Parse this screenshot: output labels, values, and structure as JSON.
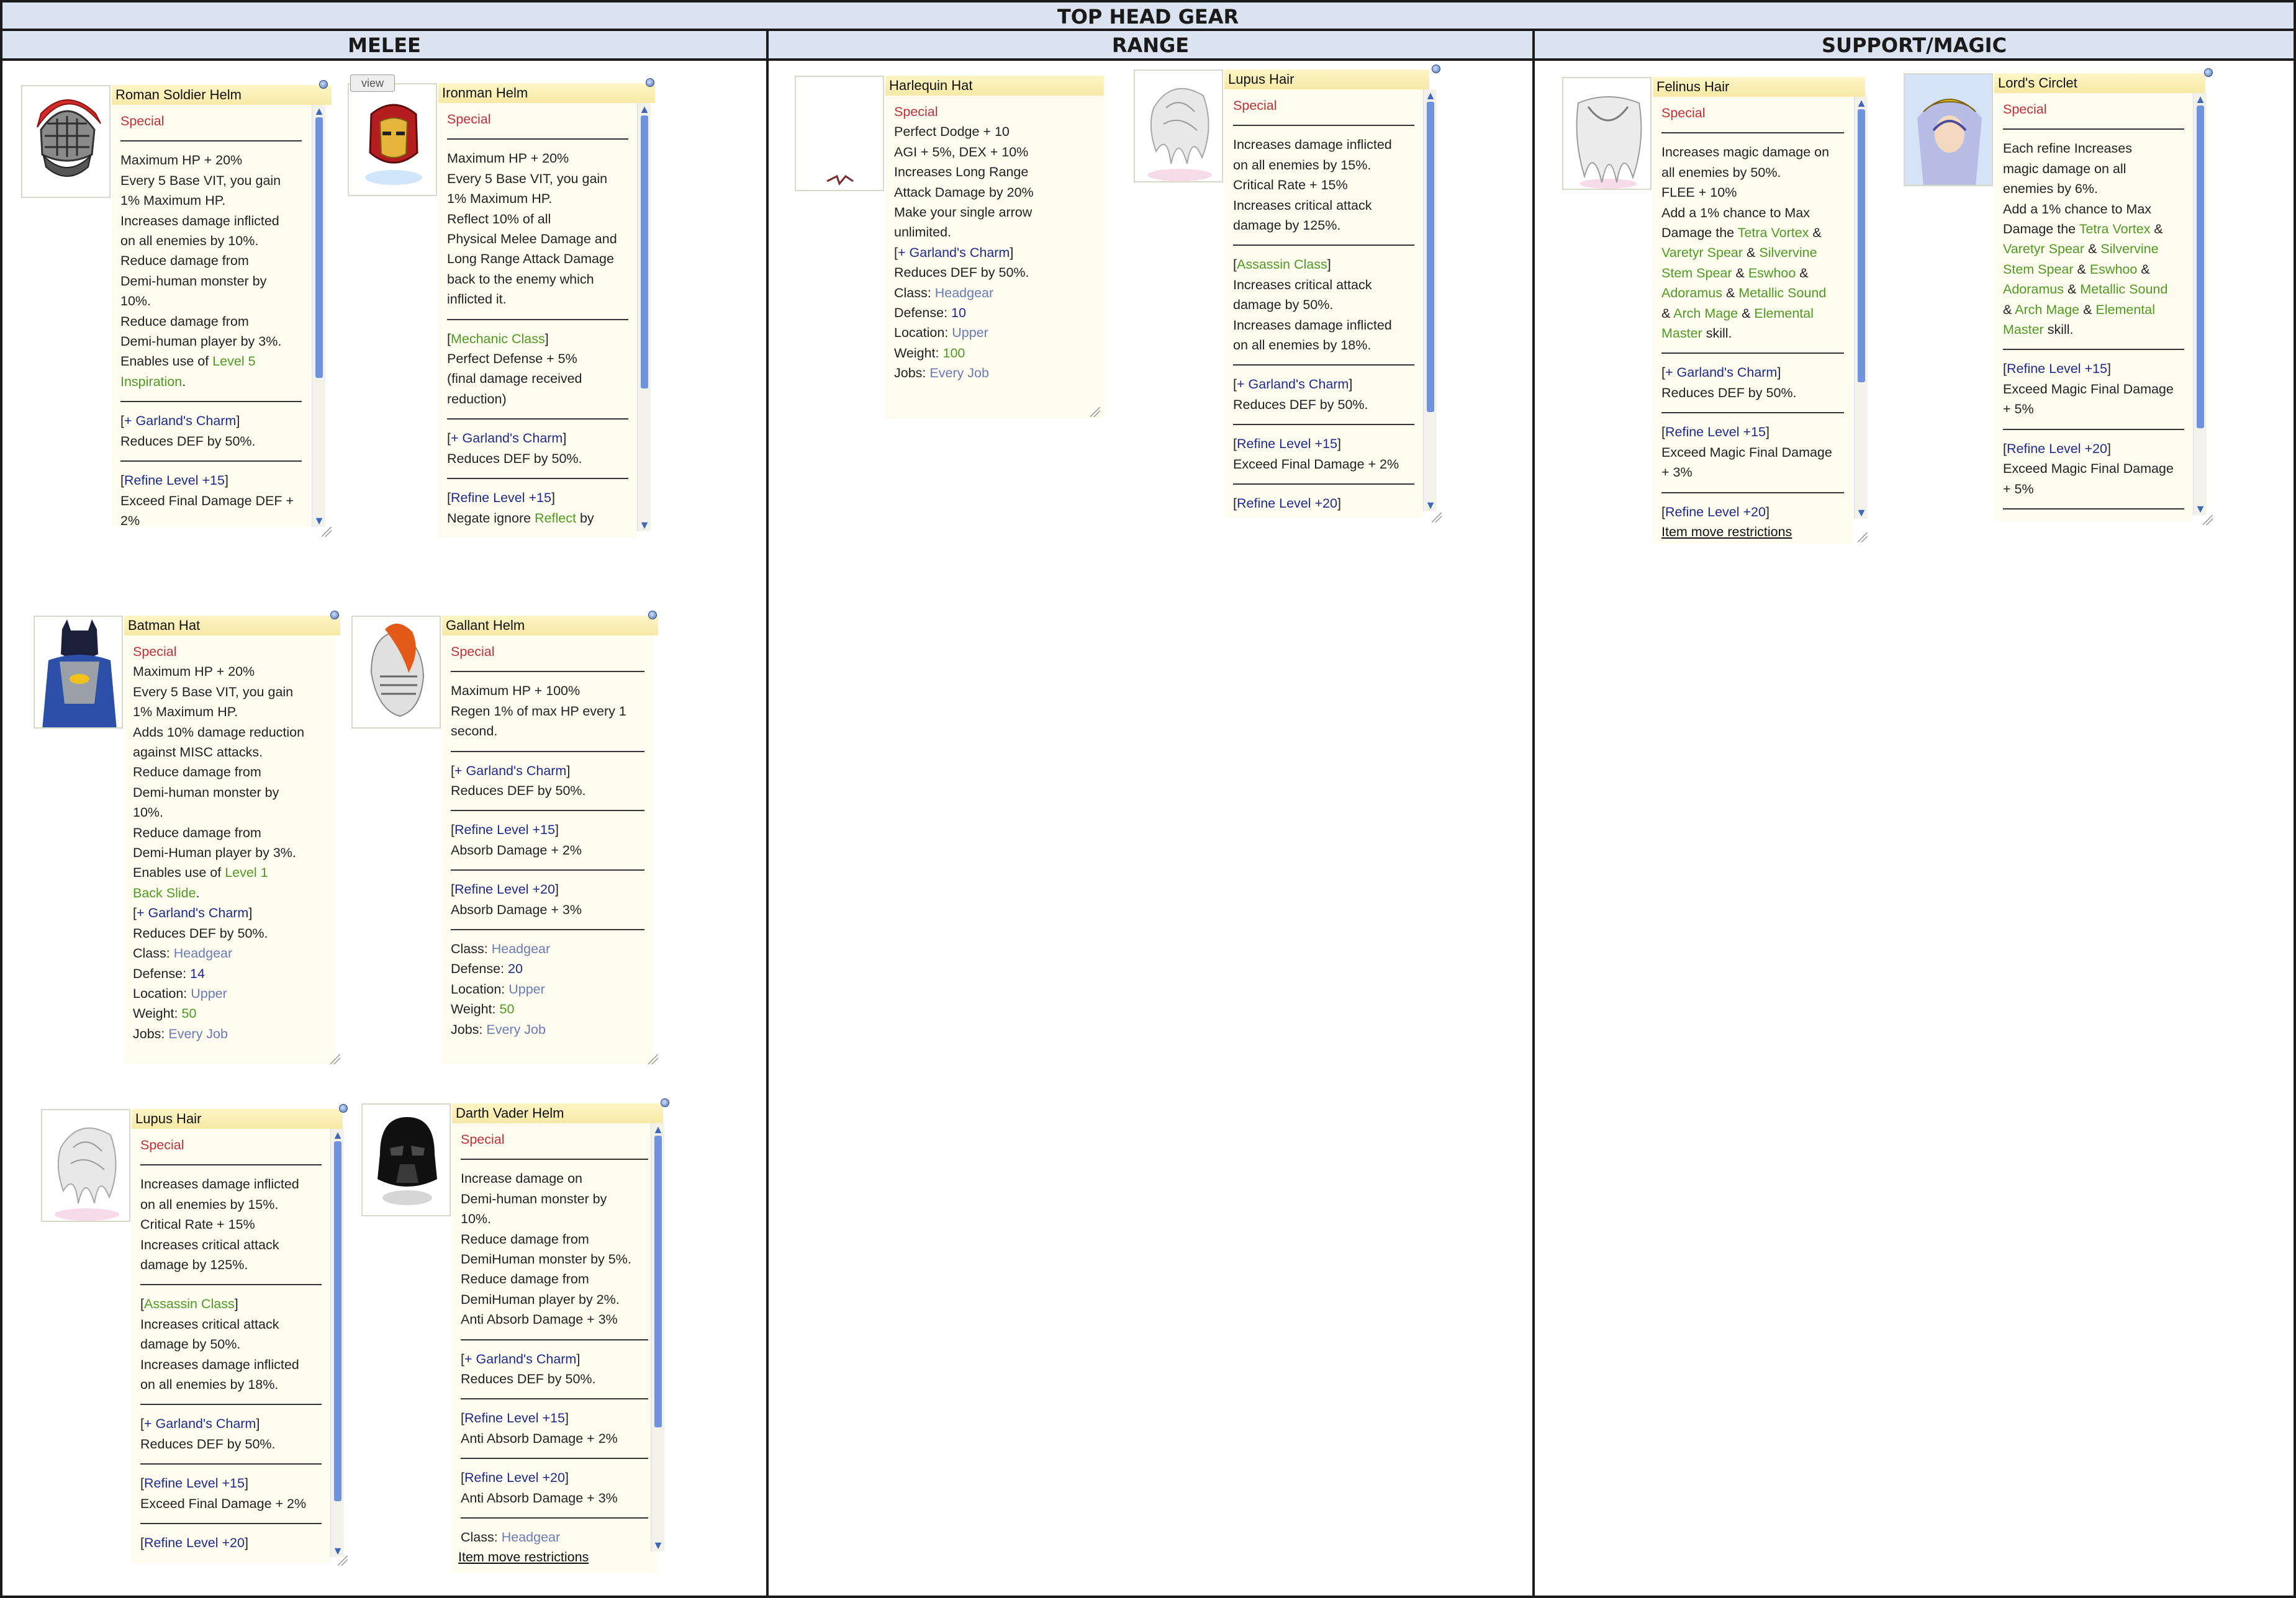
{
  "title": "TOP HEAD GEAR",
  "columns": {
    "melee": "MELEE",
    "range": "RANGE",
    "support": "SUPPORT/MAGIC"
  },
  "cards": {
    "roman": {
      "name": "Roman Soldier Helm",
      "lines": [
        "Special",
        "Maximum HP + 20%",
        "Every 5 Base VIT, you gain",
        "1% Maximum HP.",
        "Increases damage inflicted",
        "on all enemies by 10%.",
        "Reduce damage from",
        "Demi-human monster by",
        "10%.",
        "Reduce damage from",
        "Demi-human player by 3%.",
        "Enables use of ",
        "Level 5",
        "Inspiration",
        ".",
        "[",
        "+ Garland's Charm",
        "]",
        "Reduces DEF by 50%.",
        "[",
        "Refine Level +15",
        "]",
        "Exceed Final Damage DEF +",
        "2%"
      ]
    },
    "ironman": {
      "name": "Ironman Helm",
      "view": "view",
      "lines": [
        "Special",
        "Maximum HP + 20%",
        "Every 5 Base VIT, you gain",
        "1% Maximum HP.",
        "Reflect 10% of all",
        "Physical Melee Damage and",
        "Long Range Attack Damage",
        "back to the enemy which",
        "inflicted it.",
        "[",
        "Mechanic Class",
        "]",
        "Perfect Defense + 5%",
        "(final damage received",
        "reduction)",
        "[",
        "+ Garland's Charm",
        "]",
        "Reduces DEF by 50%.",
        "[",
        "Refine Level +15",
        "]",
        "Negate ignore ",
        "Reflect",
        " by"
      ]
    },
    "batman": {
      "name": "Batman Hat",
      "lines": [
        "Special",
        "Maximum HP + 20%",
        "Every 5 Base VIT, you gain",
        "1% Maximum HP.",
        "Adds 10% damage reduction",
        "against MISC attacks.",
        "Reduce damage from",
        "Demi-human monster by",
        "10%.",
        "Reduce damage from",
        "Demi-Human player by 3%.",
        "Enables use of ",
        "Level 1",
        "Back Slide",
        ".",
        "[",
        "+ Garland's Charm",
        "]",
        "Reduces DEF by 50%.",
        "Class: ",
        "Headgear",
        "Defense: ",
        "14",
        "Location: ",
        "Upper",
        "Weight: ",
        "50",
        "Jobs: ",
        "Every Job"
      ]
    },
    "gallant": {
      "name": "Gallant Helm",
      "lines": [
        "Special",
        "Maximum HP + 100%",
        "Regen 1% of max HP every 1",
        "second.",
        "[",
        "+ Garland's Charm",
        "]",
        "Reduces DEF by 50%.",
        "[",
        "Refine Level +15",
        "]",
        "Absorb Damage + 2%",
        "[",
        "Refine Level +20",
        "]",
        "Absorb Damage + 3%",
        "Class: ",
        "Headgear",
        "Defense: ",
        "20",
        "Location: ",
        "Upper",
        "Weight: ",
        "50",
        "Jobs: ",
        "Every Job"
      ]
    },
    "lupus1": {
      "name": "Lupus Hair",
      "lines": [
        "Special",
        "Increases damage inflicted",
        "on all enemies by 15%.",
        "Critical Rate + 15%",
        "Increases critical attack",
        "damage by 125%.",
        "[",
        "Assassin Class",
        "]",
        "Increases critical attack",
        "damage by 50%.",
        "Increases damage inflicted",
        "on all enemies by 18%.",
        "[",
        "+ Garland's Charm",
        "]",
        "Reduces DEF by 50%.",
        "[",
        "Refine Level +15",
        "]",
        "Exceed Final Damage + 2%",
        "[",
        "Refine Level +20",
        "]"
      ]
    },
    "vader": {
      "name": "Darth Vader Helm",
      "lines": [
        "Special",
        "Increase damage on",
        "Demi-human monster by",
        "10%.",
        "Reduce damage from",
        "DemiHuman monster by 5%.",
        "Reduce damage from",
        "DemiHuman player by 2%.",
        "Anti Absorb Damage + 3%",
        "[",
        "+ Garland's Charm",
        "]",
        "Reduces DEF by 50%.",
        "[",
        "Refine Level +15",
        "]",
        "Anti Absorb Damage + 2%",
        "[",
        "Refine Level +20",
        "]",
        "Anti Absorb Damage + 3%",
        "Class: ",
        "Headgear",
        "Item move restrictions"
      ]
    },
    "harlequin": {
      "name": "Harlequin Hat",
      "lines": [
        "Special",
        "Perfect Dodge + 10",
        "AGI + 5%, DEX + 10%",
        "Increases Long Range",
        "Attack Damage by 20%",
        "Make your single arrow",
        "unlimited.",
        "[",
        "+ Garland's Charm",
        "]",
        "Reduces DEF by 50%.",
        "Class: ",
        "Headgear",
        "Defense: ",
        "10",
        "Location: ",
        "Upper",
        "Weight: ",
        "100",
        "Jobs: ",
        "Every Job"
      ]
    },
    "lupus2": {
      "name": "Lupus Hair",
      "lines": [
        "Special",
        "Increases damage inflicted",
        "on all enemies by 15%.",
        "Critical Rate + 15%",
        "Increases critical attack",
        "damage by 125%.",
        "[",
        "Assassin Class",
        "]",
        "Increases critical attack",
        "damage by 50%.",
        "Increases damage inflicted",
        "on all enemies by 18%.",
        "[",
        "+ Garland's Charm",
        "]",
        "Reduces DEF by 50%.",
        "[",
        "Refine Level +15",
        "]",
        "Exceed Final Damage + 2%",
        "[",
        "Refine Level +20",
        "]"
      ]
    },
    "felinus": {
      "name": "Felinus Hair",
      "lines": [
        "Special",
        "Increases magic damage on",
        "all enemies by 50%.",
        "FLEE + 10%",
        "Add a 1% chance to Max",
        "Damage the ",
        "Tetra Vortex",
        " &",
        "Varetyr Spear",
        " & ",
        "Silvervine",
        "Stem Spear",
        " & ",
        "Eswhoo",
        " &",
        "Adoramus",
        " & ",
        "Metallic Sound",
        "& ",
        "Arch Mage",
        " & ",
        "Elemental",
        "Master",
        " skill.",
        "[",
        "+ Garland's Charm",
        "]",
        "Reduces DEF by 50%.",
        "[",
        "Refine Level +15",
        "]",
        "Exceed Magic Final Damage",
        "+ 3%",
        "[",
        "Refine Level +20",
        "]",
        "Item move restrictions"
      ]
    },
    "lords": {
      "name": "Lord's Circlet",
      "lines": [
        "Special",
        "Each refine Increases",
        "magic damage on all",
        "enemies by 6%.",
        "Add a 1% chance to Max",
        "Damage the ",
        "Tetra Vortex",
        " &",
        "Varetyr Spear",
        " & ",
        "Silvervine",
        "Stem Spear",
        " & ",
        "Eswhoo",
        " &",
        "Adoramus",
        " & ",
        "Metallic Sound",
        "& ",
        "Arch Mage",
        " & ",
        "Elemental",
        "Master",
        " skill.",
        "[",
        "Refine Level +15",
        "]",
        "Exceed Magic Final Damage",
        "+ 5%",
        "[",
        "Refine Level +20",
        "]",
        "Exceed Magic Final Damage",
        "+ 5%"
      ]
    }
  }
}
